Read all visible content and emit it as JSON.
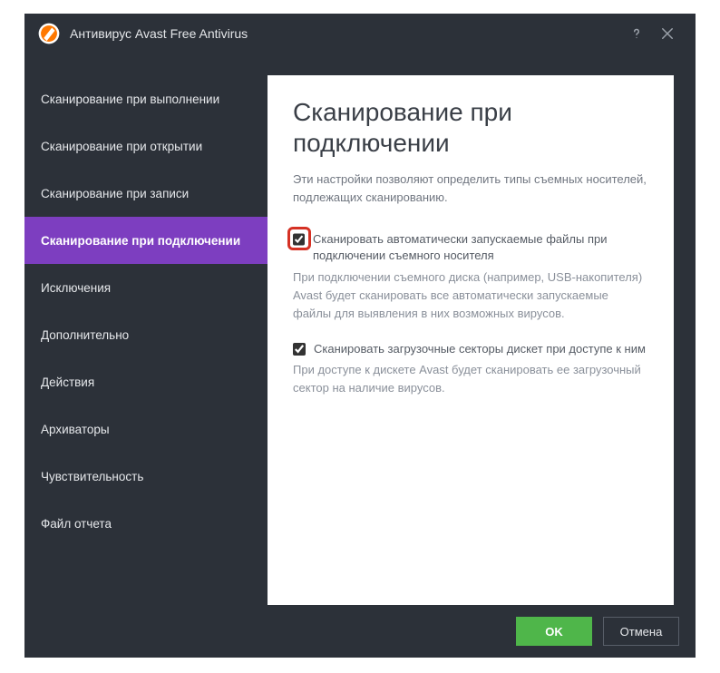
{
  "titlebar": {
    "title": "Антивирус Avast Free Antivirus"
  },
  "sidebar": {
    "items": [
      {
        "label": "Сканирование при выполнении"
      },
      {
        "label": "Сканирование при открытии"
      },
      {
        "label": "Сканирование при записи"
      },
      {
        "label": "Сканирование при подключении"
      },
      {
        "label": "Исключения"
      },
      {
        "label": "Дополнительно"
      },
      {
        "label": "Действия"
      },
      {
        "label": "Архиваторы"
      },
      {
        "label": "Чувствительность"
      },
      {
        "label": "Файл отчета"
      }
    ],
    "active_index": 3
  },
  "content": {
    "heading": "Сканирование при подключении",
    "intro": "Эти настройки позволяют определить типы съемных носителей, подлежащих сканированию.",
    "options": [
      {
        "checked": true,
        "label": "Сканировать автоматически запускаемые файлы при подключении съемного носителя",
        "desc": "При подключении съемного диска (например, USB-накопителя) Avast будет сканировать все автоматически запускаемые файлы для выявления в них возможных вирусов."
      },
      {
        "checked": true,
        "label": "Сканировать загрузочные секторы дискет при доступе к ним",
        "desc": "При доступе к дискете Avast будет сканировать ее загрузочный сектор на наличие вирусов."
      }
    ]
  },
  "footer": {
    "ok": "OK",
    "cancel": "Отмена"
  }
}
